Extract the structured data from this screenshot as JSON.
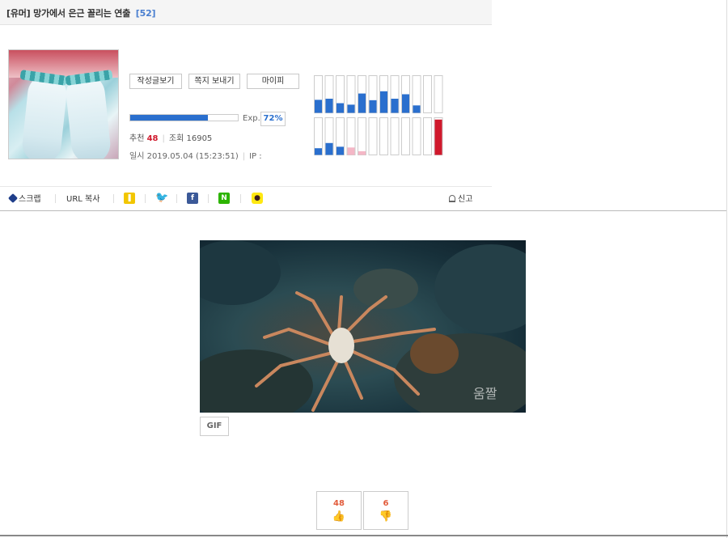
{
  "post": {
    "category": "[유머]",
    "title": "망가에서 은근 꼴리는 연출",
    "comment_count": "[52]"
  },
  "profile": {
    "buttons": {
      "posts": "작성글보기",
      "message": "쪽지 보내기",
      "mypi": "마이피"
    },
    "exp": {
      "label": "Exp.",
      "percent_text": "72%",
      "percent": 72
    },
    "stats": {
      "recommend_label": "추천",
      "recommend_value": "48",
      "views_label": "조회",
      "views_value": "16905",
      "date": "일시 2019.05.04 (15:23:51)",
      "ip": "IP :"
    }
  },
  "chart_data": {
    "type": "bar",
    "series": [
      {
        "values": [
          0.35,
          0.38,
          0.26,
          0.22,
          0.52,
          0.34,
          0.58,
          0.38,
          0.5,
          0.2
        ]
      },
      {
        "values": [
          0.18,
          0.32,
          0.22,
          0.2,
          0.1,
          0.0,
          0.0,
          0.0,
          0.0,
          0.0,
          0.0,
          0.95
        ]
      }
    ],
    "colors": {
      "primary": "#2a6fce",
      "faded": "#f4b7c6",
      "alert": "#d0192c"
    }
  },
  "share": {
    "scrap": "스크랩",
    "url_copy": "URL 복사",
    "report": "신고",
    "icons": [
      "yellow-share-icon",
      "twitter-icon",
      "facebook-icon",
      "naver-icon",
      "kakao-icon"
    ]
  },
  "media": {
    "badge": "GIF",
    "watermark": "움짤"
  },
  "votes": {
    "up": "48",
    "down": "6"
  }
}
